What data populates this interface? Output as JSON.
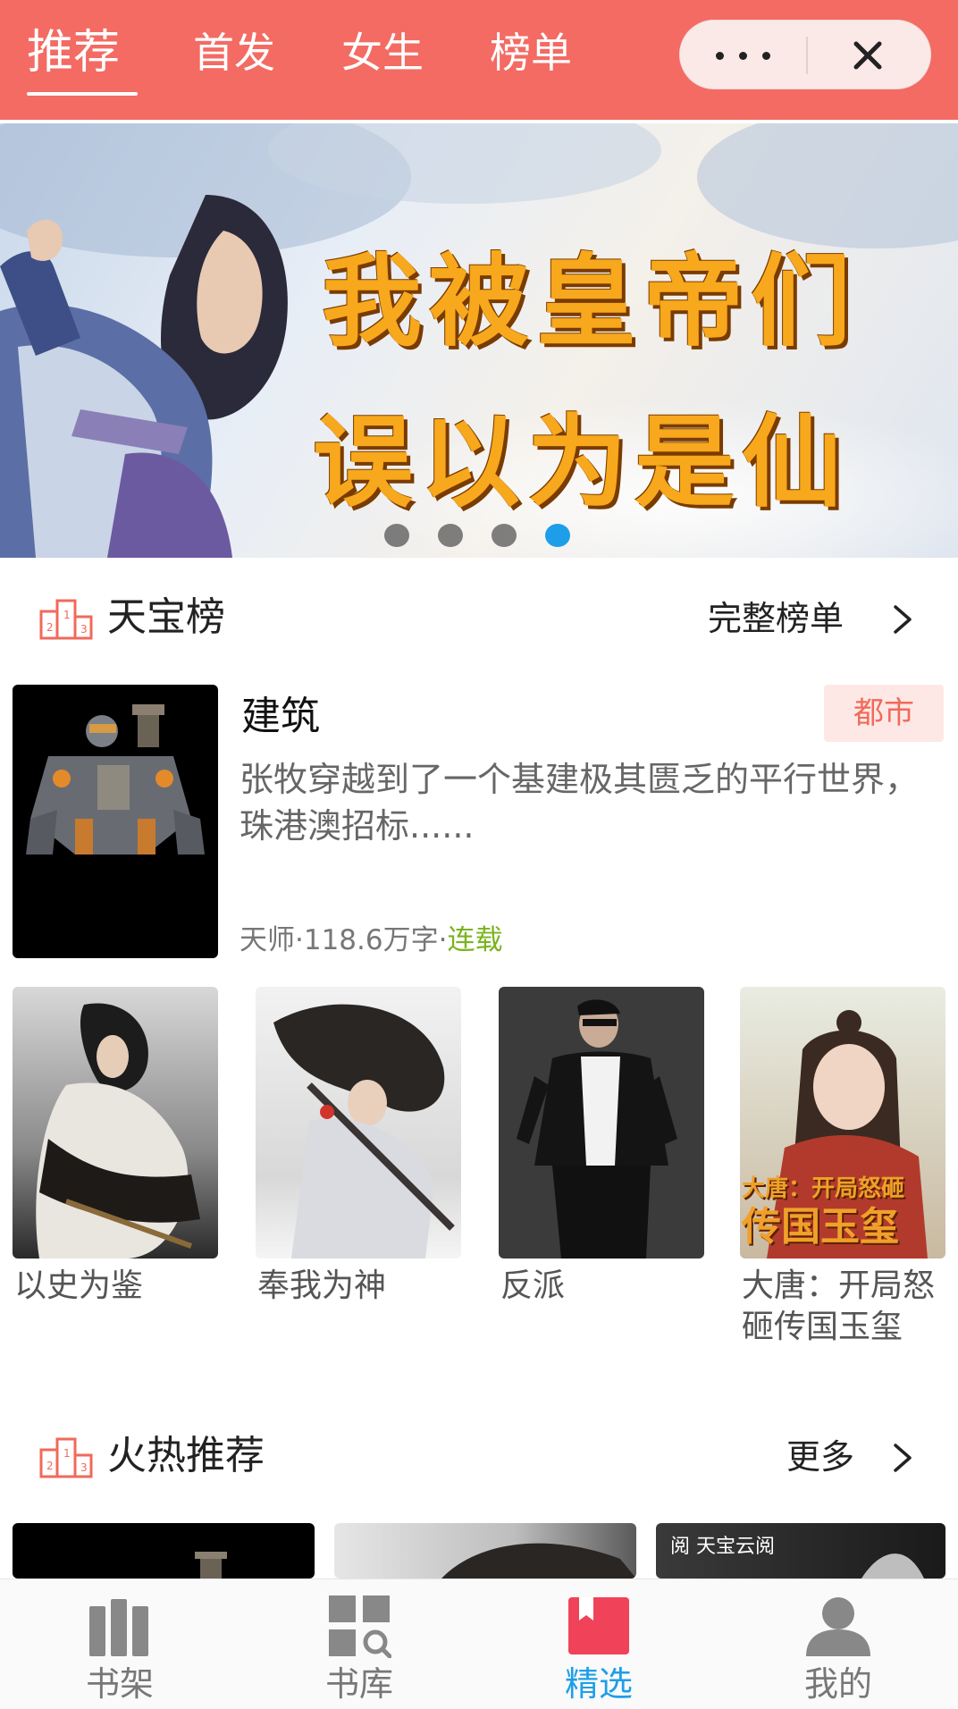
{
  "header": {
    "tabs": [
      {
        "label": "推荐",
        "active": true
      },
      {
        "label": "首发",
        "active": false
      },
      {
        "label": "女生",
        "active": false
      },
      {
        "label": "榜单",
        "active": false
      }
    ],
    "more_icon": "ellipsis-icon",
    "close_icon": "close-icon",
    "bg_color": "#f36b63"
  },
  "banner": {
    "line1": "我被皇帝们",
    "line2": "误以为是仙",
    "dot_count": 4,
    "active_dot": 4,
    "active_dot_color": "#1e9ee8"
  },
  "ranking_section": {
    "icon": "podium-icon",
    "title": "天宝榜",
    "more_label": "完整榜单"
  },
  "featured_book": {
    "title": "建筑",
    "genre": "都市",
    "description": "张牧穿越到了一个基建极其匮乏的平行世界，珠港澳招标......",
    "author": "天师",
    "separator": "·",
    "word_count": "118.6万字",
    "status": "连载",
    "status_color": "#7ab41e"
  },
  "ranking_books": [
    {
      "title": "以史为鉴"
    },
    {
      "title": "奉我为神"
    },
    {
      "title": "反派"
    },
    {
      "title": "大唐：开局怒砸传国玉玺",
      "cover_text_1": "大唐：开局怒砸",
      "cover_text_2": "传国玉玺"
    }
  ],
  "hot_section": {
    "icon": "podium-icon",
    "title": "火热推荐",
    "more_label": "更多"
  },
  "hot_books": [
    {
      "cover_badge": ""
    },
    {
      "cover_badge": ""
    },
    {
      "cover_badge": "阅 天宝云阅"
    }
  ],
  "bottom_nav": [
    {
      "label": "书架",
      "icon": "bookshelf-icon",
      "active": false
    },
    {
      "label": "书库",
      "icon": "library-search-icon",
      "active": false
    },
    {
      "label": "精选",
      "icon": "bookmark-book-icon",
      "active": true
    },
    {
      "label": "我的",
      "icon": "user-icon",
      "active": false
    }
  ],
  "colors": {
    "accent": "#1e9ee8",
    "brand": "#f36b63",
    "genre_tag_bg": "#fde8e5",
    "genre_tag_text": "#f06a5a"
  }
}
